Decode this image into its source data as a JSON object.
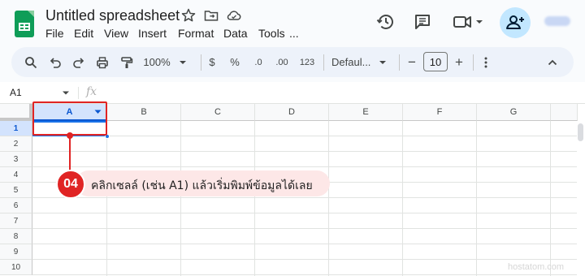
{
  "app": {
    "title": "Untitled spreadsheet",
    "menu": [
      "File",
      "Edit",
      "View",
      "Insert",
      "Format",
      "Data",
      "Tools",
      "..."
    ],
    "account_label": "",
    "accent": "#0b57d0"
  },
  "toolbar": {
    "zoom": "100%",
    "currency": "$",
    "percent": "%",
    "decrease_decimal": ".0",
    "increase_decimal": ".00",
    "number_format": "123",
    "font_family": "Defaul...",
    "minus": "−",
    "font_size": "10",
    "plus": "+"
  },
  "formula_bar": {
    "name_box": "A1",
    "fx": "fx"
  },
  "sheet": {
    "columns": [
      "A",
      "B",
      "C",
      "D",
      "E",
      "F",
      "G"
    ],
    "rows": [
      "1",
      "2",
      "3",
      "4",
      "5",
      "6",
      "7",
      "8",
      "9",
      "10"
    ],
    "selected_cell": "A1"
  },
  "annotation": {
    "step": "04",
    "text": "คลิกเซลล์ (เช่น A1) แล้วเริ่มพิมพ์ข้อมูลได้เลย",
    "color": "#e02424"
  },
  "watermark": "hostatom.com"
}
